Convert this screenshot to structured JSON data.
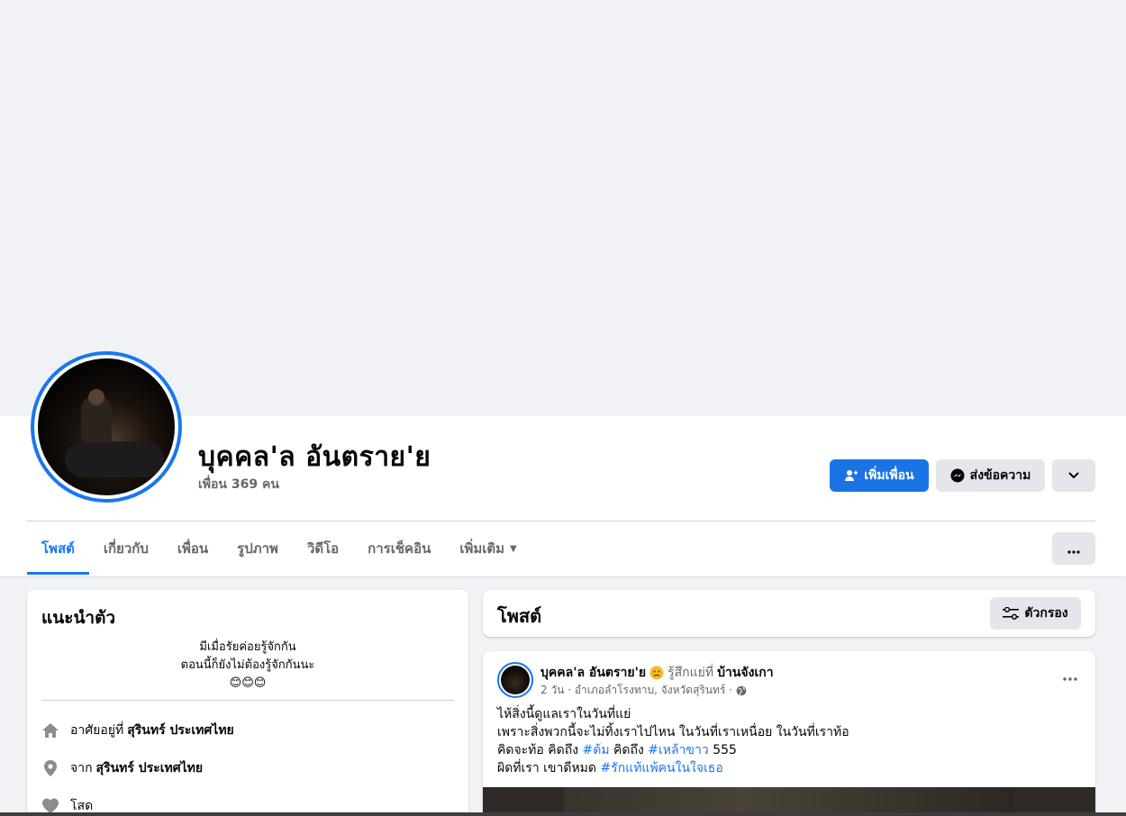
{
  "profile": {
    "name": "บุคคล'ล อันตราย'ย",
    "friends_count": "เพื่อน 369 คน"
  },
  "actions": {
    "add_friend": "เพิ่มเพื่อน",
    "message": "ส่งข้อความ"
  },
  "tabs": [
    {
      "label": "โพสต์",
      "active": true
    },
    {
      "label": "เกี่ยวกับ"
    },
    {
      "label": "เพื่อน"
    },
    {
      "label": "รูปภาพ"
    },
    {
      "label": "วิดีโอ"
    },
    {
      "label": "การเช็คอิน"
    },
    {
      "label": "เพิ่มเติม"
    }
  ],
  "intro": {
    "title": "แนะนำตัว",
    "bio_lines": [
      "มีเมื่อรัยค่อยรู้จักกัน",
      "ตอนนี้ก็ยังไม่ต้องรู้จักกันนะ",
      "😊😊😊"
    ],
    "lives_in_prefix": "อาศัยอยู่ที่",
    "lives_in": "สุรินทร์ ประเทศไทย",
    "from_prefix": "จาก",
    "from": "สุรินทร์ ประเทศไทย",
    "relationship": "โสด"
  },
  "posts_header": {
    "title": "โพสต์",
    "filter": "ตัวกรอง"
  },
  "post": {
    "author": "บุคคล'ล อันตราย'ย",
    "feeling": "รู้สึกแย่ที่",
    "place": "บ้านจังเกา",
    "meta": "2 วัน · อำเภอลำโรงทาบ, จังหวัดสุรินทร์ ·",
    "line1": "ไห้สิ่งนี้ดูแลเราในวันที่แย่",
    "line2": "เพราะสิ่งพวกนี้จะไม่ทิ้งเราไปไหน ในวันที่เราเหนื่อย ในวันที่เราท้อ",
    "line3_a": "คิดจะท้อ คิดถึง",
    "line3_tag1": "#ต้ม",
    "line3_b": "คิดถึง",
    "line3_tag2": "#เหล้าขาว",
    "line3_c": "555",
    "line4_a": "ผิดที่เรา เขาดีหมด",
    "line4_tag": "#รักแท้แพ้คนในใจเธอ"
  },
  "colors": {
    "accent": "#1877f2",
    "page_bg": "#f0f2f5",
    "secondary_button": "#e4e6eb"
  }
}
